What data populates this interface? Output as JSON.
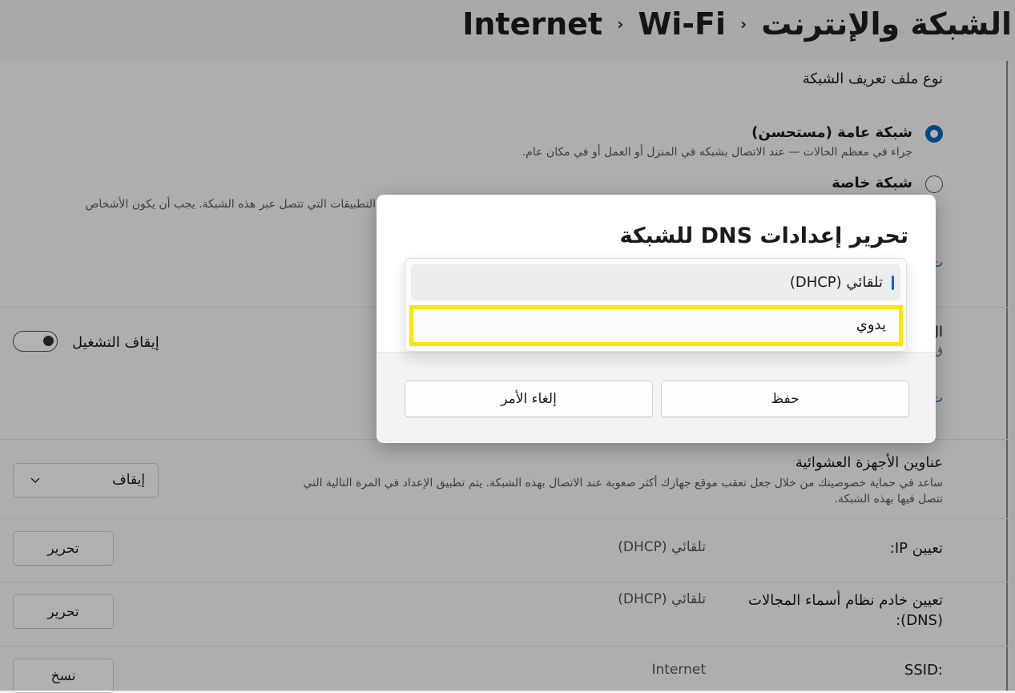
{
  "header": {
    "breadcrumb": [
      "الشبكة والإنترنت",
      "Wi-Fi",
      "Internet"
    ],
    "separator": "‹"
  },
  "profile": {
    "heading": "نوع ملف تعريف الشبكة",
    "public_label": "شبكة عامة (مستحسن)",
    "public_desc": "جراء في معظم الحالات — عند الاتصال بشبكه في المنزل أو العمل أو في مكان عام.",
    "private_label": "شبكة خاصة",
    "private_desc": "التطبيقات التي تتصل عبر هذه الشبكة. يجب أن يكون الأشخاص",
    "link_partial_1": "ت",
    "link_partial_2": "ت"
  },
  "metered": {
    "title_partial": "ال",
    "sub_partial": "ق",
    "toggle_label": "إيقاف التشغيل",
    "toggle_state": "off"
  },
  "random_hw": {
    "title": "عناوين الأجهزة العشوائية",
    "desc_line1": "ساعد في حماية خصوصيتك من خلال جعل تعقب موقع جهازك أكثر صعوبة عند الاتصال بهذه الشبكة. يتم تطبيق الإعداد في المرة التالية التي",
    "desc_line2": "تتصل فيها بهذه الشبكة.",
    "select_value": "إيقاف",
    "chevron_icon": "chevron-down-icon"
  },
  "ip_assignment": {
    "label": "تعيين IP:",
    "value": "تلقائي (DHCP)",
    "button": "تحرير"
  },
  "dns_assignment": {
    "label_line1": "تعيين خادم نظام أسماء المجالات",
    "label_line2": "(DNS):",
    "value": "تلقائي (DHCP)",
    "button": "تحرير"
  },
  "ssid": {
    "label": "SSID:",
    "value": "Internet",
    "button": "نسخ"
  },
  "dialog": {
    "title": "تحرير إعدادات DNS للشبكة",
    "options": [
      "تلقائي (DHCP)",
      "يدوي"
    ],
    "selected_index": 0,
    "highlighted_index": 1,
    "save_label": "حفظ",
    "cancel_label": "إلغاء الأمر"
  },
  "colors": {
    "accent": "#0067c0",
    "highlight": "#ffe600"
  }
}
